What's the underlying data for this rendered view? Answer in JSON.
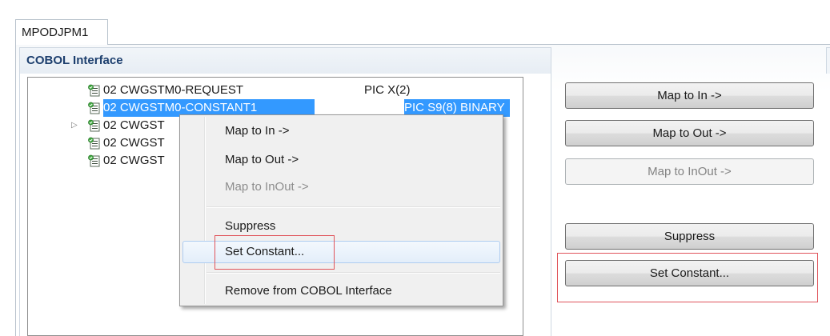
{
  "editor_tab": {
    "label": "MPODJPM1"
  },
  "section": {
    "title": "COBOL Interface"
  },
  "tree": {
    "rows": [
      {
        "name": "02 CWGSTM0-REQUEST",
        "pic": "PIC X(2)",
        "icon": "cobol-field-icon",
        "expandable": false,
        "selected": false
      },
      {
        "name": "02 CWGSTM0-CONSTANT1",
        "pic": "PIC S9(8) BINARY",
        "icon": "cobol-field-icon",
        "expandable": false,
        "selected": true
      },
      {
        "name": "02 CWGST",
        "pic": "",
        "icon": "cobol-field-icon",
        "expandable": true,
        "selected": false
      },
      {
        "name": "02 CWGST",
        "pic": "",
        "icon": "cobol-field-icon",
        "expandable": false,
        "selected": false
      },
      {
        "name": "02 CWGST",
        "pic": "",
        "icon": "cobol-field-icon",
        "expandable": false,
        "selected": false
      }
    ]
  },
  "context_menu": {
    "map_to_in": "Map to In ->",
    "map_to_out": "Map to Out ->",
    "map_to_inout": "Map to InOut ->",
    "suppress": "Suppress",
    "set_constant": "Set Constant...",
    "remove": "Remove from COBOL Interface"
  },
  "buttons": {
    "map_to_in": "Map to In ->",
    "map_to_out": "Map to Out ->",
    "map_to_inout": "Map to InOut ->",
    "suppress": "Suppress",
    "set_constant": "Set Constant..."
  },
  "colors": {
    "selection": "#3399ff",
    "highlight_box": "#e0545b",
    "section_title": "#1d3f6e"
  }
}
